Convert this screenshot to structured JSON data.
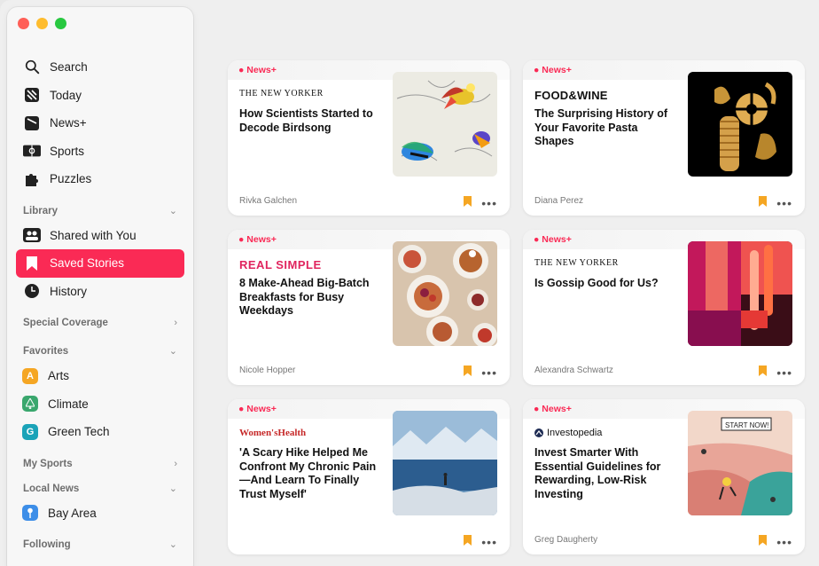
{
  "sidebar": {
    "nav": [
      {
        "label": "Search",
        "icon": "search-icon"
      },
      {
        "label": "Today",
        "icon": "news-logo-icon"
      },
      {
        "label": "News+",
        "icon": "news-plus-icon"
      },
      {
        "label": "Sports",
        "icon": "sports-icon"
      },
      {
        "label": "Puzzles",
        "icon": "puzzle-icon"
      }
    ],
    "library_label": "Library",
    "library": [
      {
        "label": "Shared with You",
        "icon": "people-icon"
      },
      {
        "label": "Saved Stories",
        "icon": "bookmark-icon",
        "active": true
      },
      {
        "label": "History",
        "icon": "clock-icon"
      }
    ],
    "special_coverage_label": "Special Coverage",
    "favorites_label": "Favorites",
    "favorites": [
      {
        "label": "Arts",
        "badge": "A",
        "color": "#f5a623"
      },
      {
        "label": "Climate",
        "badge": "🌲",
        "color": "#3aa76d"
      },
      {
        "label": "Green Tech",
        "badge": "G",
        "color": "#1aa3b8"
      }
    ],
    "my_sports_label": "My Sports",
    "local_news_label": "Local News",
    "local": [
      {
        "label": "Bay Area",
        "badge": "📍",
        "color": "#3d8ee8"
      }
    ],
    "following_label": "Following"
  },
  "news_plus_label": "News+",
  "cards": [
    {
      "publication": "THE NEW YORKER",
      "headline": "How Scientists Started to Decode Birdsong",
      "author": "Rivka Galchen"
    },
    {
      "publication": "FOOD&WINE",
      "headline": "The Surprising History of Your Favorite Pasta Shapes",
      "author": "Diana Perez"
    },
    {
      "publication": "REAL SIMPLE",
      "headline": "8 Make-Ahead Big-Batch Breakfasts for Busy Weekdays",
      "author": "Nicole Hopper"
    },
    {
      "publication": "THE NEW YORKER",
      "headline": "Is Gossip Good for Us?",
      "author": "Alexandra Schwartz"
    },
    {
      "publication": "Women'sHealth",
      "headline": "'A Scary Hike Helped Me Confront My Chronic Pain—And Learn To Finally Trust Myself'",
      "author": ""
    },
    {
      "publication": "Investopedia",
      "headline": "Invest Smarter With Essential Guidelines for Rewarding, Low-Risk Investing",
      "author": "Greg Daugherty"
    }
  ],
  "colors": {
    "accent": "#fa2a55",
    "bookmark": "#f5a623"
  }
}
